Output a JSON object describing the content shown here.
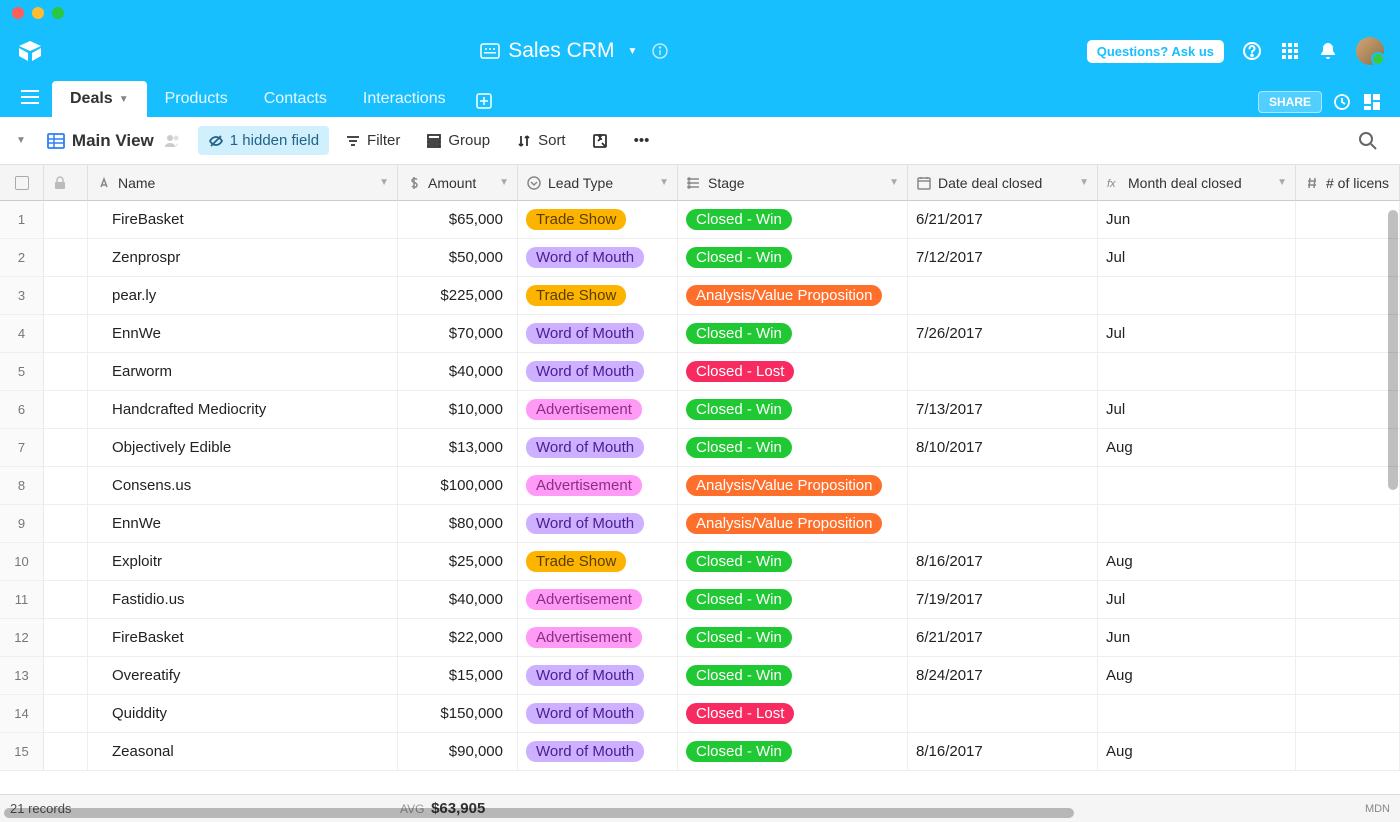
{
  "header": {
    "base_title": "Sales CRM",
    "questions_label": "Questions? Ask us"
  },
  "tabs": {
    "items": [
      "Deals",
      "Products",
      "Contacts",
      "Interactions"
    ],
    "share_label": "SHARE"
  },
  "toolbar": {
    "view_name": "Main View",
    "hidden_field": "1 hidden field",
    "filter": "Filter",
    "group": "Group",
    "sort": "Sort"
  },
  "columns": {
    "name": "Name",
    "amount": "Amount",
    "lead_type": "Lead Type",
    "stage": "Stage",
    "date_closed": "Date deal closed",
    "month_closed": "Month deal closed",
    "licenses": "# of licens"
  },
  "lead_types": {
    "trade_show": "Trade Show",
    "word_of_mouth": "Word of Mouth",
    "advertisement": "Advertisement"
  },
  "stages": {
    "closed_win": "Closed - Win",
    "closed_lost": "Closed - Lost",
    "analysis": "Analysis/Value Proposition"
  },
  "rows": [
    {
      "n": "1",
      "name": "FireBasket",
      "amount": "$65,000",
      "lead": "trade_show",
      "stage": "closed_win",
      "date": "6/21/2017",
      "month": "Jun"
    },
    {
      "n": "2",
      "name": "Zenprospr",
      "amount": "$50,000",
      "lead": "word_of_mouth",
      "stage": "closed_win",
      "date": "7/12/2017",
      "month": "Jul"
    },
    {
      "n": "3",
      "name": "pear.ly",
      "amount": "$225,000",
      "lead": "trade_show",
      "stage": "analysis",
      "date": "",
      "month": ""
    },
    {
      "n": "4",
      "name": "EnnWe",
      "amount": "$70,000",
      "lead": "word_of_mouth",
      "stage": "closed_win",
      "date": "7/26/2017",
      "month": "Jul"
    },
    {
      "n": "5",
      "name": "Earworm",
      "amount": "$40,000",
      "lead": "word_of_mouth",
      "stage": "closed_lost",
      "date": "",
      "month": ""
    },
    {
      "n": "6",
      "name": "Handcrafted Mediocrity",
      "amount": "$10,000",
      "lead": "advertisement",
      "stage": "closed_win",
      "date": "7/13/2017",
      "month": "Jul"
    },
    {
      "n": "7",
      "name": "Objectively Edible",
      "amount": "$13,000",
      "lead": "word_of_mouth",
      "stage": "closed_win",
      "date": "8/10/2017",
      "month": "Aug"
    },
    {
      "n": "8",
      "name": "Consens.us",
      "amount": "$100,000",
      "lead": "advertisement",
      "stage": "analysis",
      "date": "",
      "month": ""
    },
    {
      "n": "9",
      "name": "EnnWe",
      "amount": "$80,000",
      "lead": "word_of_mouth",
      "stage": "analysis",
      "date": "",
      "month": ""
    },
    {
      "n": "10",
      "name": "Exploitr",
      "amount": "$25,000",
      "lead": "trade_show",
      "stage": "closed_win",
      "date": "8/16/2017",
      "month": "Aug"
    },
    {
      "n": "11",
      "name": "Fastidio.us",
      "amount": "$40,000",
      "lead": "advertisement",
      "stage": "closed_win",
      "date": "7/19/2017",
      "month": "Jul"
    },
    {
      "n": "12",
      "name": "FireBasket",
      "amount": "$22,000",
      "lead": "advertisement",
      "stage": "closed_win",
      "date": "6/21/2017",
      "month": "Jun"
    },
    {
      "n": "13",
      "name": "Overeatify",
      "amount": "$15,000",
      "lead": "word_of_mouth",
      "stage": "closed_win",
      "date": "8/24/2017",
      "month": "Aug"
    },
    {
      "n": "14",
      "name": "Quiddity",
      "amount": "$150,000",
      "lead": "word_of_mouth",
      "stage": "closed_lost",
      "date": "",
      "month": ""
    },
    {
      "n": "15",
      "name": "Zeasonal",
      "amount": "$90,000",
      "lead": "word_of_mouth",
      "stage": "closed_win",
      "date": "8/16/2017",
      "month": "Aug"
    }
  ],
  "footer": {
    "records": "21 records",
    "avg_label": "AVG",
    "avg_value": "$63,905",
    "right": "MDN"
  }
}
